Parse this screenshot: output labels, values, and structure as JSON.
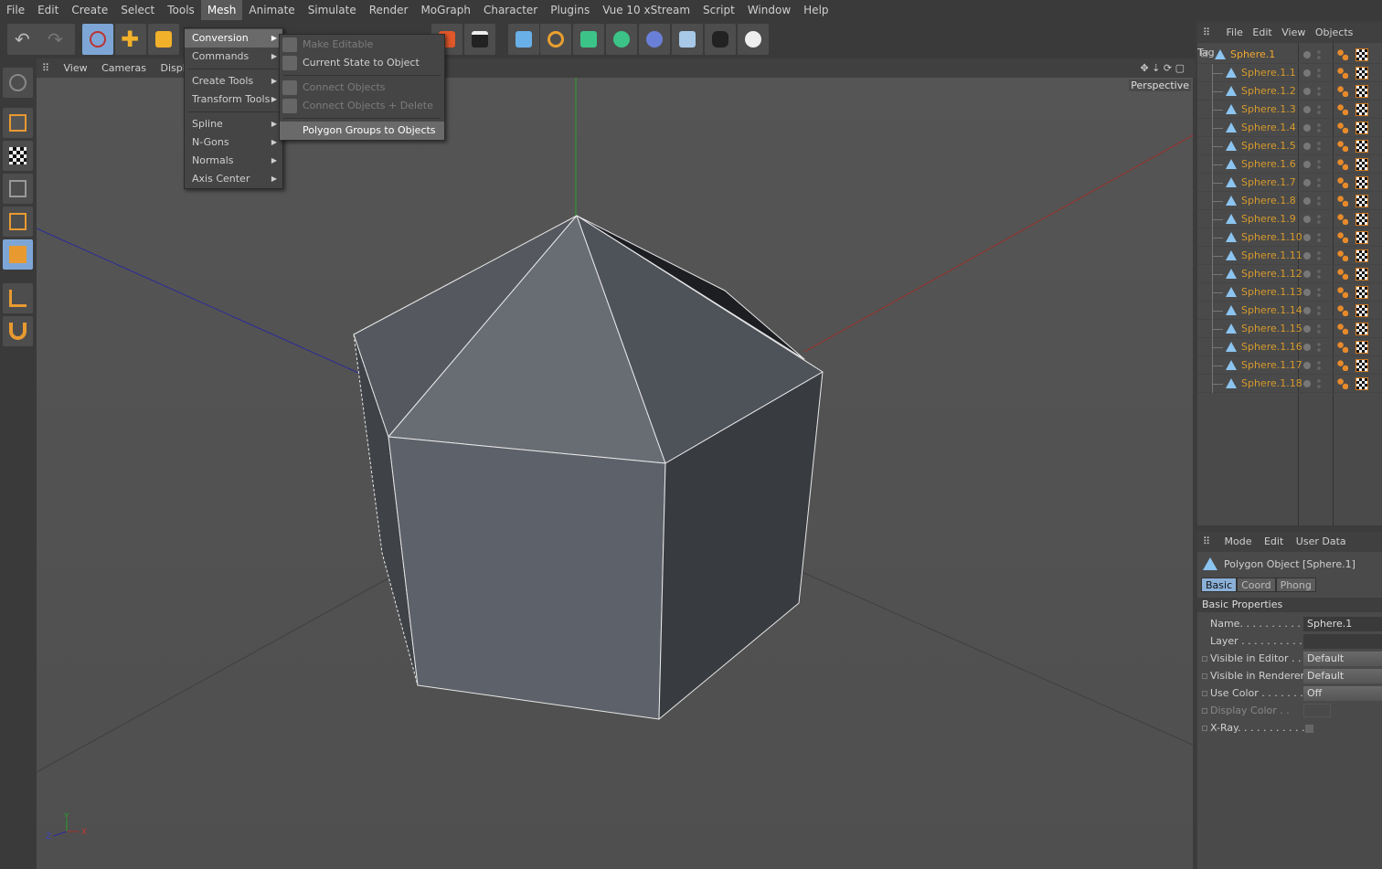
{
  "menubar": [
    "File",
    "Edit",
    "Create",
    "Select",
    "Tools",
    "Mesh",
    "Animate",
    "Simulate",
    "Render",
    "MoGraph",
    "Character",
    "Plugins",
    "Vue 10 xStream",
    "Script",
    "Window",
    "Help"
  ],
  "active_menu": "Mesh",
  "mesh_menu": [
    {
      "label": "Conversion",
      "submenu": true,
      "highlighted": true
    },
    {
      "label": "Commands",
      "submenu": true
    },
    {
      "sep": true
    },
    {
      "label": "Create Tools",
      "submenu": true
    },
    {
      "label": "Transform Tools",
      "submenu": true
    },
    {
      "sep": true
    },
    {
      "label": "Spline",
      "submenu": true
    },
    {
      "label": "N-Gons",
      "submenu": true
    },
    {
      "label": "Normals",
      "submenu": true
    },
    {
      "label": "Axis Center",
      "submenu": true
    }
  ],
  "conversion_submenu": [
    {
      "label": "Make Editable",
      "disabled": true
    },
    {
      "label": "Current State to Object",
      "disabled": false
    },
    {
      "sep": true
    },
    {
      "label": "Connect Objects",
      "disabled": true
    },
    {
      "label": "Connect Objects + Delete",
      "disabled": true
    },
    {
      "sep": true
    },
    {
      "label": "Polygon Groups to Objects",
      "disabled": false,
      "highlighted": true
    }
  ],
  "viewport": {
    "menu": [
      "View",
      "Cameras",
      "Display"
    ],
    "camera_label": "Perspective",
    "axis_labels": {
      "x": "X",
      "y": "Y",
      "z": "Z"
    }
  },
  "object_manager": {
    "menu": [
      "File",
      "Edit",
      "View",
      "Objects",
      "Tag"
    ],
    "objects": [
      "Sphere.1",
      "Sphere.1.1",
      "Sphere.1.2",
      "Sphere.1.3",
      "Sphere.1.4",
      "Sphere.1.5",
      "Sphere.1.6",
      "Sphere.1.7",
      "Sphere.1.8",
      "Sphere.1.9",
      "Sphere.1.10",
      "Sphere.1.11",
      "Sphere.1.12",
      "Sphere.1.13",
      "Sphere.1.14",
      "Sphere.1.15",
      "Sphere.1.16",
      "Sphere.1.17",
      "Sphere.1.18"
    ]
  },
  "attributes": {
    "menu": [
      "Mode",
      "Edit",
      "User Data"
    ],
    "title": "Polygon Object [Sphere.1]",
    "tabs": [
      "Basic",
      "Coord",
      "Phong"
    ],
    "active_tab": "Basic",
    "section": "Basic Properties",
    "props": [
      {
        "label": "Name. . . . . . . . . . .",
        "value": "Sphere.1",
        "type": "text"
      },
      {
        "label": "Layer . . . . . . . . . . .",
        "value": "",
        "type": "text"
      },
      {
        "label": "Visible in Editor . .",
        "value": "Default",
        "type": "dropdown"
      },
      {
        "label": "Visible in Renderer",
        "value": "Default",
        "type": "dropdown"
      },
      {
        "label": "Use Color . . . . . . .",
        "value": "Off",
        "type": "dropdown"
      },
      {
        "label": "Display Color . .",
        "value": "",
        "type": "color",
        "disabled": true
      },
      {
        "label": "X-Ray. . . . . . . . . . .",
        "value": "",
        "type": "checkbox"
      }
    ]
  },
  "colors": {
    "object_name": "#d69a2c",
    "axis_x": "#a03028",
    "axis_y": "#2aa02a",
    "axis_z": "#2a2aa0",
    "selection": "#8ab0d8"
  }
}
